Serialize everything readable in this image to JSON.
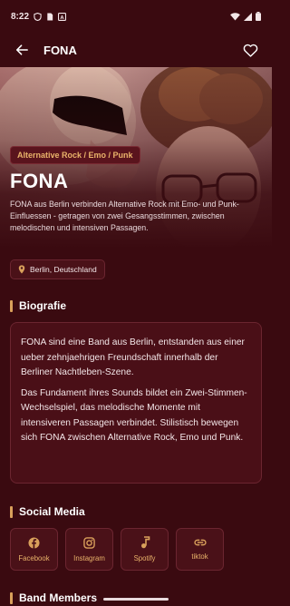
{
  "status": {
    "time": "8:22"
  },
  "header": {
    "title": "FONA"
  },
  "hero": {
    "genre": "Alternative Rock / Emo / Punk",
    "name": "FONA",
    "description": "FONA aus Berlin verbinden Alternative Rock mit Emo- und Punk-Einfluessen - getragen von zwei Gesangsstimmen, zwischen melodischen und intensiven Passagen."
  },
  "location": "Berlin, Deutschland",
  "biography": {
    "title": "Biografie",
    "paragraphs": [
      "FONA sind eine Band aus Berlin, entstanden aus einer ueber zehnjaehrigen Freundschaft innerhalb der Berliner Nachtleben-Szene.",
      "Das Fundament ihres Sounds bildet ein Zwei-Stimmen-Wechselspiel, das melodische Momente mit intensiveren Passagen verbindet. Stilistisch bewegen sich FONA zwischen Alternative Rock, Emo und Punk."
    ]
  },
  "social": {
    "title": "Social Media",
    "items": [
      {
        "label": "Facebook",
        "icon": "facebook-icon"
      },
      {
        "label": "Instagram",
        "icon": "instagram-icon"
      },
      {
        "label": "Spotify",
        "icon": "music-note-icon"
      },
      {
        "label": "tiktok",
        "icon": "link-icon"
      }
    ]
  },
  "members": {
    "title": "Band Members"
  },
  "colors": {
    "background": "#3a0a10",
    "accent": "#d9a05b",
    "card": "#4a0f17"
  }
}
